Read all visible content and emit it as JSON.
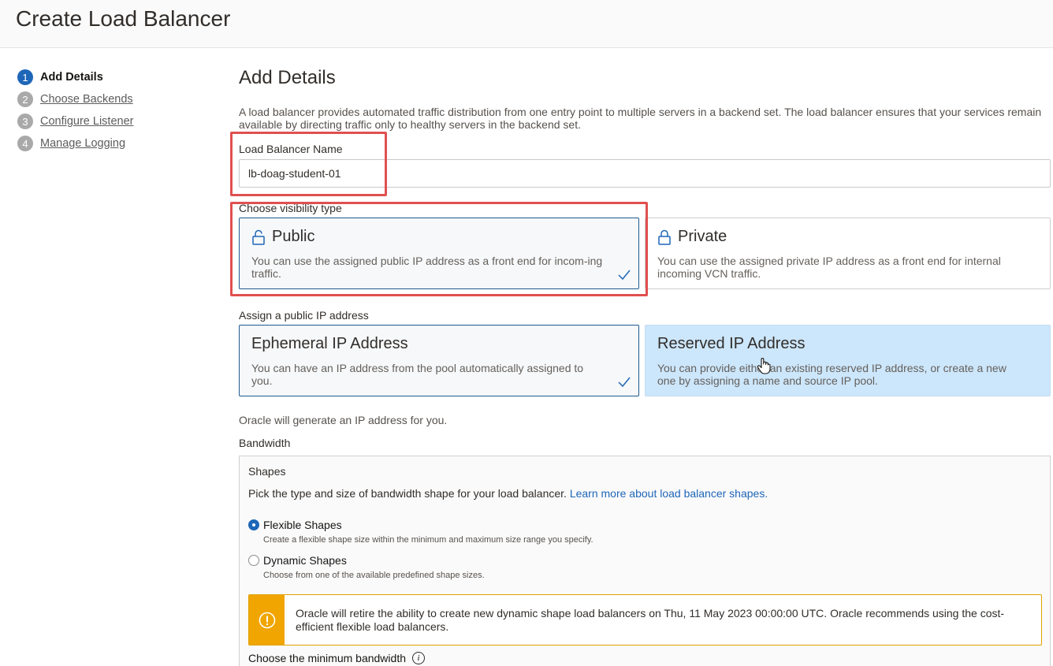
{
  "header": {
    "title": "Create Load Balancer"
  },
  "steps": [
    {
      "num": "1",
      "label": "Add Details"
    },
    {
      "num": "2",
      "label": "Choose Backends"
    },
    {
      "num": "3",
      "label": "Configure Listener"
    },
    {
      "num": "4",
      "label": "Manage Logging"
    }
  ],
  "section": {
    "title": "Add Details",
    "description": "A load balancer provides automated traffic distribution from one entry point to multiple servers in a backend set. The load balancer ensures that your services remain available by directing traffic only to healthy servers in the backend set."
  },
  "name_field": {
    "label": "Load Balancer Name",
    "value": "lb-doag-student-01"
  },
  "visibility": {
    "label": "Choose visibility type",
    "public": {
      "title": "Public",
      "desc": "You can use the assigned public IP address as a front end for incom-ing traffic.",
      "icon": "unlock-icon"
    },
    "private": {
      "title": "Private",
      "desc": "You can use the assigned private IP address as a front end for internal incoming VCN traffic.",
      "icon": "lock-icon"
    }
  },
  "public_ip": {
    "label": "Assign a public IP address",
    "ephemeral": {
      "title": "Ephemeral IP Address",
      "desc": "You can have an IP address from the pool automatically assigned to you."
    },
    "reserved": {
      "title": "Reserved IP Address",
      "desc": "You can provide either an existing reserved IP address, or create a new one by assigning a name and source IP pool."
    }
  },
  "note": "Oracle will generate an IP address for you.",
  "bandwidth": {
    "label": "Bandwidth",
    "shapes_title": "Shapes",
    "shapes_desc": "Pick the type and size of bandwidth shape for your load balancer.",
    "learn_more": "Learn more about load balancer shapes.",
    "flexible": {
      "label": "Flexible Shapes",
      "help": "Create a flexible shape size within the minimum and maximum size range you specify."
    },
    "dynamic": {
      "label": "Dynamic Shapes",
      "help": "Choose from one of the available predefined shape sizes."
    },
    "warning": "Oracle will retire the ability to create new dynamic shape load balancers on Thu, 11 May 2023 00:00:00 UTC. Oracle recommends using the cost-efficient flexible load balancers.",
    "min_bandwidth_label": "Choose the minimum bandwidth",
    "info_glyph": "i"
  },
  "colors": {
    "accent": "#1e66b8",
    "highlight": "#e05050",
    "warning": "#f0a500"
  }
}
